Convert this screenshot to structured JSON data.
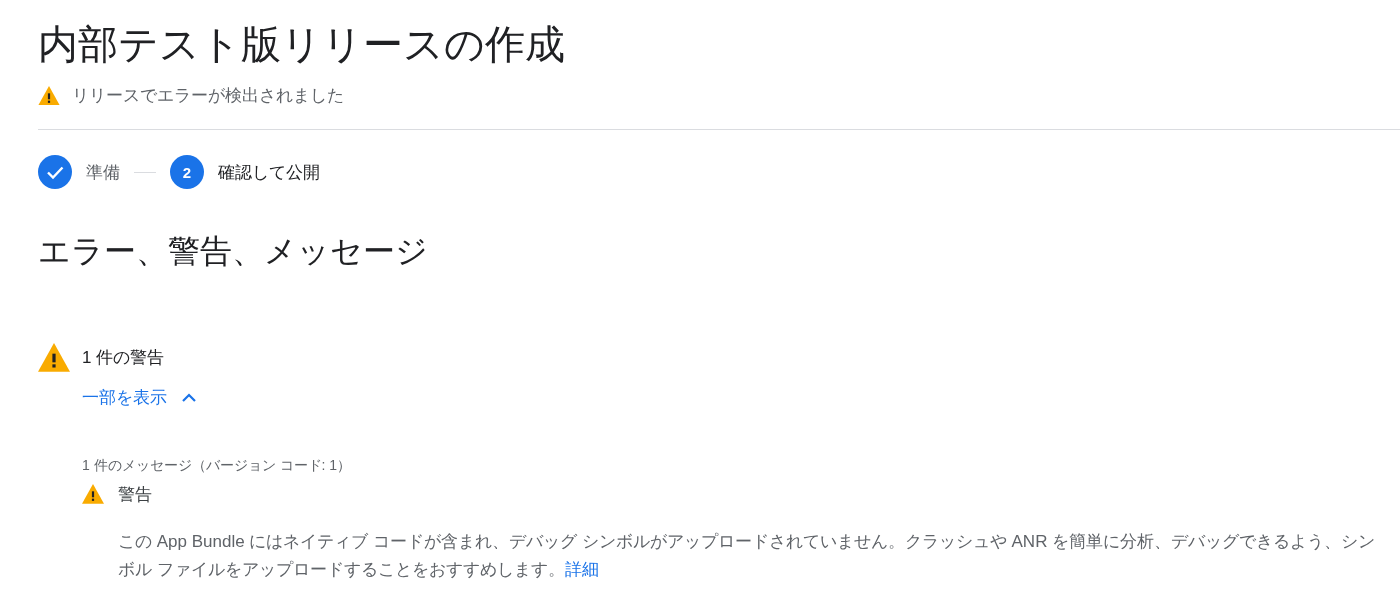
{
  "page_title": "内部テスト版リリースの作成",
  "release_status": "リリースでエラーが検出されました",
  "steps": [
    {
      "label": "準備",
      "completed": true
    },
    {
      "label": "確認して公開",
      "completed": false,
      "number": "2"
    }
  ],
  "section_title": "エラー、警告、メッセージ",
  "warning_group": {
    "summary": "1 件の警告",
    "toggle": "一部を表示",
    "expanded": true,
    "messages": [
      {
        "heading": "1 件のメッセージ（バージョン コード: 1）",
        "severity": "警告",
        "body": "この App Bundle にはネイティブ コードが含まれ、デバッグ シンボルがアップロードされていません。クラッシュや ANR を簡単に分析、デバッグできるよう、シンボル ファイルをアップロードすることをおすすめします。",
        "link": "詳細"
      }
    ]
  }
}
